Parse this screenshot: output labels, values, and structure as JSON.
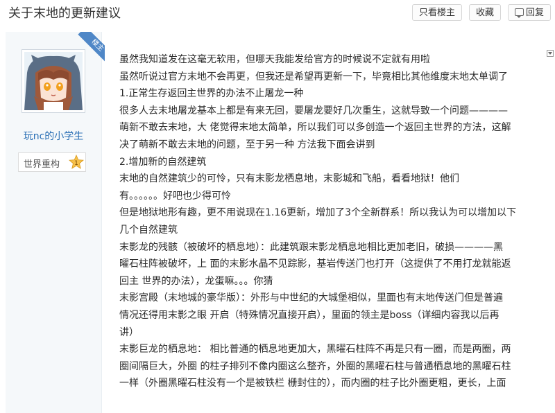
{
  "thread": {
    "title": "关于末地的更新建议"
  },
  "toolbar": {
    "only_op_label": "只看楼主",
    "favorite_label": "收藏",
    "reply_label": "回复"
  },
  "author": {
    "badge": "楼主",
    "name": "玩nc的小学生",
    "rank_label": "世界重构",
    "rank_level": "1"
  },
  "post": {
    "lines": [
      "虽然我知道发在这毫无软用，但哪天我能发给官方的时候说不定就有用啦",
      "虽然听说过官方末地不会再更，但我还是希望再更新一下，毕竟相比其他维度末地太单调了",
      "1.正常生存返回主世界的办法不止屠龙一种",
      "很多人去末地屠龙基本上都是有来无回，要屠龙要好几次重生，这就导致一个问题————",
      "萌新不敢去末地，大 佬觉得末地太简单，所以我们可以多创造一个返回主世界的方法，这解",
      "决了萌新不敢去末地的问题，至于另一种 方法我下面会讲到",
      "2.增加新的自然建筑",
      "末地的自然建筑少的可怜，只有末影龙栖息地，末影城和飞船，看看地狱！他们",
      "有。。。。。。好吧也少得可怜",
      "但是地狱地形有趣，更不用说现在1.16更新，增加了3个全新群系！所以我认为可以增加以下",
      "几个自然建筑",
      "末影龙的残骸（被破坏的栖息地）：此建筑跟末影龙栖息地相比更加老旧，破损————黑",
      "曜石柱阵被破坏，上 面的末影水晶不见踪影，基岩传送门也打开（这提供了不用打龙就能返",
      "回主 世界的办法），龙蛋嘛。。。你猜",
      "末影宫殿（末地城的豪华版）：外形与中世纪的大城堡相似，里面也有末地传送门但是普遍",
      "情况还得用末影之眼 开启（特殊情况直接开启），里面的领主是boss（详细内容我以后再",
      "讲）",
      "末影巨龙的栖息地： 相比普通的栖息地更加大，黑曜石柱阵不再是只有一圈，而是两圈，两",
      "圈间隔巨大，外圈 的柱子排列不像内圈这么整齐，外圈的黑曜石柱与普通栖息地的黑曜石柱",
      "一样（外圈黑曜石柱没有一个是被铁栏 栅封住的），而内圈的柱子比外圈更粗，更长，上面"
    ]
  },
  "colors": {
    "link": "#2a6fb5",
    "badge": "#4f87c7",
    "sidebar_bg": "#f5f8fa"
  }
}
